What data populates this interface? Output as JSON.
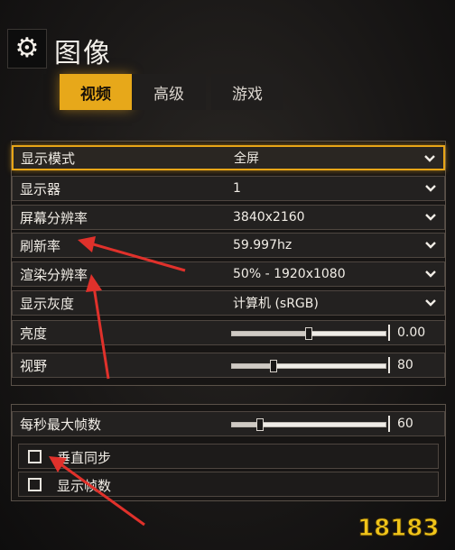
{
  "header": {
    "gear_icon": "gear-icon",
    "title": "图像"
  },
  "tabs": [
    {
      "label": "视频",
      "active": true
    },
    {
      "label": "高级",
      "active": false
    },
    {
      "label": "游戏",
      "active": false
    }
  ],
  "settings": [
    {
      "label": "显示模式",
      "value": "全屏",
      "type": "dropdown"
    },
    {
      "label": "显示器",
      "value": "1",
      "type": "dropdown"
    },
    {
      "label": "屏幕分辨率",
      "value": "3840x2160",
      "type": "dropdown"
    },
    {
      "label": "刷新率",
      "value": "59.997hz",
      "type": "dropdown"
    },
    {
      "label": "渲染分辨率",
      "value": "50% - 1920x1080",
      "type": "dropdown"
    },
    {
      "label": "显示灰度",
      "value": "计算机 (sRGB)",
      "type": "dropdown"
    },
    {
      "label": "亮度",
      "value": "0.00",
      "type": "slider",
      "level": 0.5
    },
    {
      "label": "视野",
      "value": "80",
      "type": "slider",
      "level": 0.27
    }
  ],
  "fps": {
    "label": "每秒最大帧数",
    "value": "60",
    "level": 0.18
  },
  "checkboxes": [
    {
      "label": "垂直同步",
      "checked": false
    },
    {
      "label": "显示帧数",
      "checked": false
    }
  ],
  "watermark": {
    "text": "18183"
  },
  "colors": {
    "accent": "#e7a81a",
    "annotation_arrow": "#e0312b",
    "background": "#1a1817"
  }
}
